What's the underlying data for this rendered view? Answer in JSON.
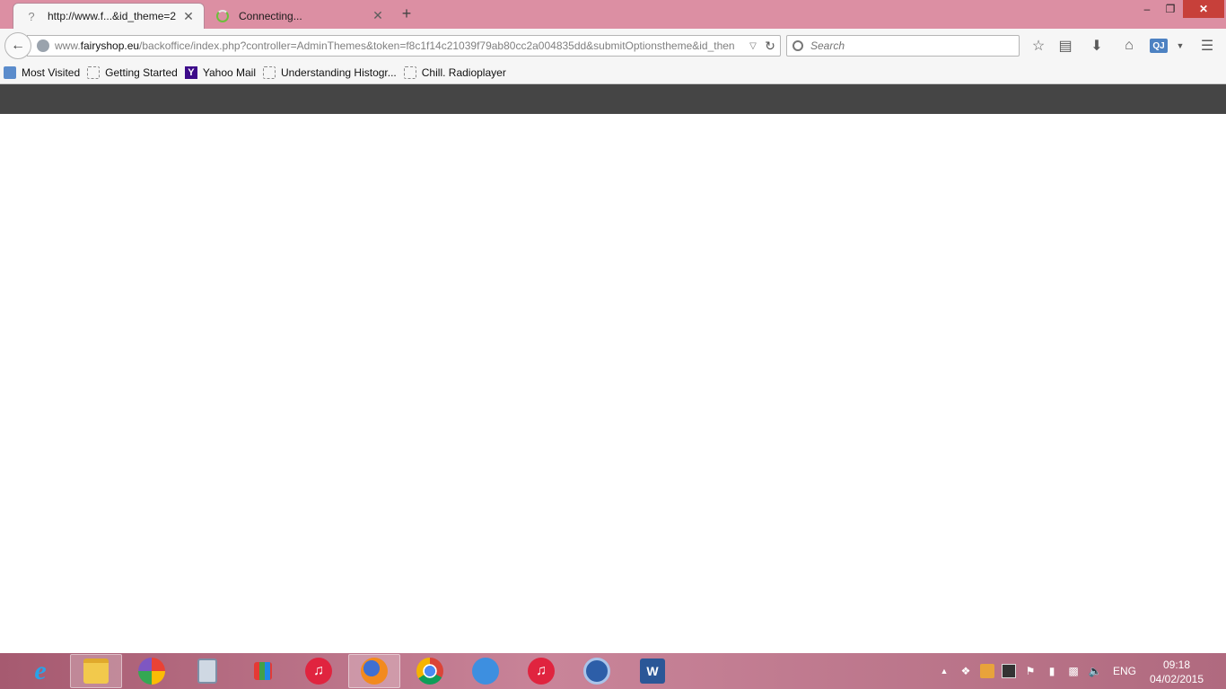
{
  "browser": {
    "tabs": [
      {
        "label": "http://www.f...&id_theme=2",
        "favicon": "unknown-page-icon",
        "active": true
      },
      {
        "label": "Connecting...",
        "favicon": "loading-spinner-icon",
        "active": false
      }
    ],
    "new_tab_symbol": "+",
    "window_controls": {
      "minimize": "–",
      "restore": "❐",
      "close": "✕"
    }
  },
  "navbar": {
    "url_prefix": "www.",
    "url_domain": "fairyshop.eu",
    "url_path": "/backoffice/index.php?controller=AdminThemes&token=f8c1f14c21039f79ab80cc2a004835dd&submitOptionstheme&id_then",
    "search_placeholder": "Search",
    "profile_badge": "QJ"
  },
  "bookmarks": [
    {
      "label": "Most Visited",
      "icon": "most-visited-icon"
    },
    {
      "label": "Getting Started",
      "icon": "blank-page-icon"
    },
    {
      "label": "Yahoo Mail",
      "icon": "yahoo-icon"
    },
    {
      "label": "Understanding Histogr...",
      "icon": "blank-page-icon"
    },
    {
      "label": "Chill. Radioplayer",
      "icon": "blank-page-icon"
    }
  ],
  "taskbar": {
    "apps": [
      {
        "name": "internet-explorer",
        "glyph": "e"
      },
      {
        "name": "file-explorer",
        "glyph": ""
      },
      {
        "name": "picasa",
        "glyph": ""
      },
      {
        "name": "calculator",
        "glyph": ""
      },
      {
        "name": "apps-grid",
        "glyph": ""
      },
      {
        "name": "itunes",
        "glyph": "♫"
      },
      {
        "name": "firefox",
        "glyph": ""
      },
      {
        "name": "chrome",
        "glyph": ""
      },
      {
        "name": "messenger",
        "glyph": ""
      },
      {
        "name": "itunes-2",
        "glyph": "♫"
      },
      {
        "name": "sync-app",
        "glyph": ""
      },
      {
        "name": "word",
        "glyph": "W"
      }
    ],
    "language": "ENG",
    "time": "09:18",
    "date": "04/02/2015"
  },
  "colors": {
    "titlebar": "#dc8fa3",
    "page_header": "#454545",
    "close_button": "#c7403a"
  }
}
